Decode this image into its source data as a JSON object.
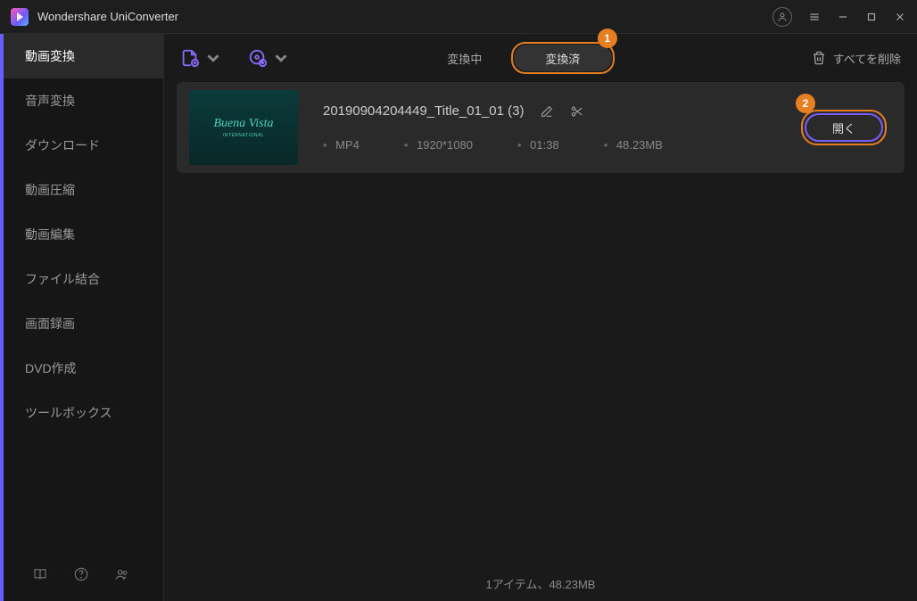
{
  "app": {
    "title": "Wondershare UniConverter"
  },
  "sidebar": {
    "items": [
      {
        "label": "動画変換"
      },
      {
        "label": "音声変換"
      },
      {
        "label": "ダウンロード"
      },
      {
        "label": "動画圧縮"
      },
      {
        "label": "動画編集"
      },
      {
        "label": "ファイル結合"
      },
      {
        "label": "画面録画"
      },
      {
        "label": "DVD作成"
      },
      {
        "label": "ツールボックス"
      }
    ]
  },
  "tabs": {
    "converting": "変換中",
    "converted": "変換済"
  },
  "toolbar": {
    "delete_all": "すべてを削除"
  },
  "annotations": {
    "badge1": "1",
    "badge2": "2"
  },
  "file": {
    "name": "20190904204449_Title_01_01 (3)",
    "thumb_text1": "Buena Vista",
    "thumb_text2": "INTERNATIONAL",
    "format": "MP4",
    "resolution": "1920*1080",
    "duration": "01:38",
    "size": "48.23MB",
    "open_label": "開く"
  },
  "status": {
    "summary": "1アイテム、48.23MB"
  }
}
